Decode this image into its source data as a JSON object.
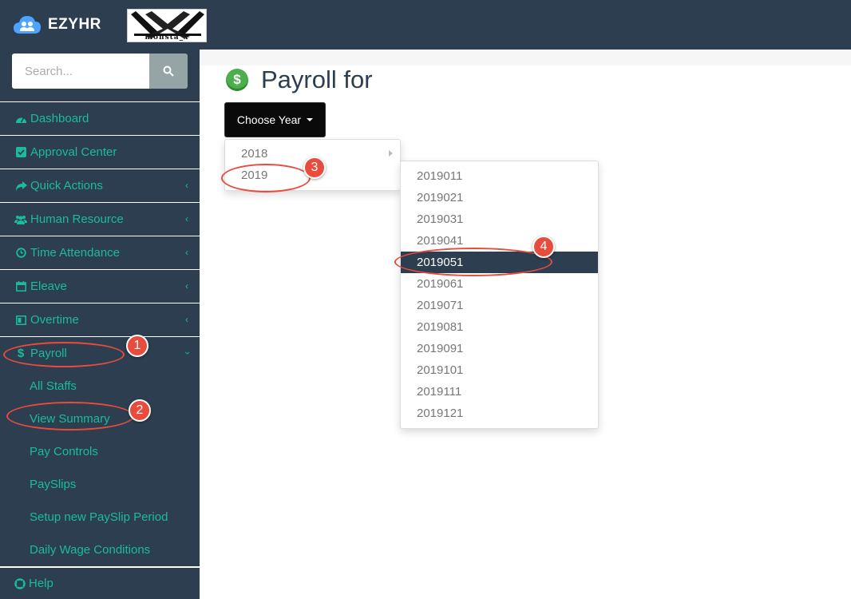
{
  "brand": {
    "name": "EZYHR",
    "partner_logo_text": "monsta_x"
  },
  "search": {
    "placeholder": "Search..."
  },
  "sidebar": {
    "items": [
      {
        "label": "Dashboard",
        "icon": "dashboard-icon"
      },
      {
        "label": "Approval Center",
        "icon": "check-square-icon"
      },
      {
        "label": "Quick Actions",
        "icon": "share-icon"
      },
      {
        "label": "Human Resource",
        "icon": "users-icon"
      },
      {
        "label": "Time Attendance",
        "icon": "clock-icon"
      },
      {
        "label": "Eleave",
        "icon": "calendar-icon"
      },
      {
        "label": "Overtime",
        "icon": "overtime-icon"
      },
      {
        "label": "Payroll",
        "icon": "dollar-icon"
      }
    ],
    "payroll_sub": [
      "All Staffs",
      "View Summary",
      "Pay Controls",
      "PaySlips",
      "Setup new PaySlip Period",
      "Daily Wage Conditions"
    ],
    "help": "Help"
  },
  "main": {
    "title": "Payroll for",
    "choose_year_label": "Choose Year",
    "years": [
      "2018",
      "2019"
    ],
    "periods": [
      "2019011",
      "2019021",
      "2019031",
      "2019041",
      "2019051",
      "2019061",
      "2019071",
      "2019081",
      "2019091",
      "2019101",
      "2019111",
      "2019121"
    ],
    "active_period": "2019051"
  },
  "annotations": [
    "1",
    "2",
    "3",
    "4"
  ],
  "colors": {
    "sidebar_bg": "#2c3e50",
    "menu_text": "#1abc9c",
    "annotation_red": "#e74c3c",
    "button_bg": "#0a0a0a"
  }
}
